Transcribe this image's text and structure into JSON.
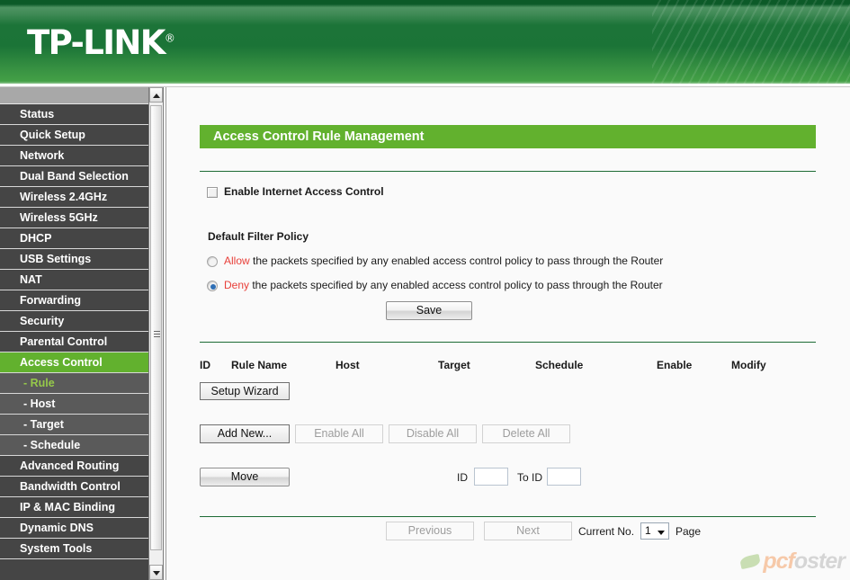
{
  "brand": {
    "name": "TP-LINK",
    "registered": "®"
  },
  "sidebar": {
    "items": [
      {
        "label": "Status",
        "type": "main",
        "state": "normal"
      },
      {
        "label": "Quick Setup",
        "type": "main",
        "state": "normal"
      },
      {
        "label": "Network",
        "type": "main",
        "state": "normal"
      },
      {
        "label": "Dual Band Selection",
        "type": "main",
        "state": "normal"
      },
      {
        "label": "Wireless 2.4GHz",
        "type": "main",
        "state": "normal"
      },
      {
        "label": "Wireless 5GHz",
        "type": "main",
        "state": "normal"
      },
      {
        "label": "DHCP",
        "type": "main",
        "state": "normal"
      },
      {
        "label": "USB Settings",
        "type": "main",
        "state": "normal"
      },
      {
        "label": "NAT",
        "type": "main",
        "state": "normal"
      },
      {
        "label": "Forwarding",
        "type": "main",
        "state": "normal"
      },
      {
        "label": "Security",
        "type": "main",
        "state": "normal"
      },
      {
        "label": "Parental Control",
        "type": "main",
        "state": "normal"
      },
      {
        "label": "Access Control",
        "type": "main",
        "state": "active"
      },
      {
        "label": "- Rule",
        "type": "sub",
        "state": "current"
      },
      {
        "label": "- Host",
        "type": "sub",
        "state": "normal"
      },
      {
        "label": "- Target",
        "type": "sub",
        "state": "normal"
      },
      {
        "label": "- Schedule",
        "type": "sub",
        "state": "normal"
      },
      {
        "label": "Advanced Routing",
        "type": "main",
        "state": "normal"
      },
      {
        "label": "Bandwidth Control",
        "type": "main",
        "state": "normal"
      },
      {
        "label": "IP & MAC Binding",
        "type": "main",
        "state": "normal"
      },
      {
        "label": "Dynamic DNS",
        "type": "main",
        "state": "normal"
      },
      {
        "label": "System Tools",
        "type": "main",
        "state": "normal"
      }
    ]
  },
  "page": {
    "title": "Access Control Rule Management",
    "enable_control_label": "Enable Internet Access Control",
    "enable_control_checked": false,
    "filter_policy_heading": "Default Filter Policy",
    "policy_allow": {
      "keyword": "Allow",
      "text": " the packets specified by any enabled access control policy to pass through the Router",
      "selected": false
    },
    "policy_deny": {
      "keyword": "Deny",
      "text": " the packets specified by any enabled access control policy to pass through the Router",
      "selected": true
    },
    "save_label": "Save"
  },
  "table": {
    "columns": [
      "ID",
      "Rule Name",
      "Host",
      "Target",
      "Schedule",
      "Enable",
      "Modify"
    ],
    "rows": []
  },
  "actions": {
    "setup_wizard": "Setup Wizard",
    "add_new": "Add New...",
    "enable_all": "Enable All",
    "disable_all": "Disable All",
    "delete_all": "Delete All",
    "move": "Move",
    "id_label": "ID",
    "id_value": "",
    "to_id_label": "To ID",
    "to_id_value": ""
  },
  "pagination": {
    "previous": "Previous",
    "next": "Next",
    "current_label": "Current No.",
    "current_page": "1",
    "page_label": "Page",
    "page_options": [
      "1"
    ]
  },
  "watermark": {
    "part1": "pcf",
    "part2": "oster"
  },
  "colors": {
    "brand_green": "#62b12e",
    "header_dark": "#1b7437",
    "sidebar_bg": "#454545",
    "sidebar_sub_bg": "#5a5a5a",
    "accent_red": "#e8403a",
    "sub_active_text": "#96c94a"
  }
}
